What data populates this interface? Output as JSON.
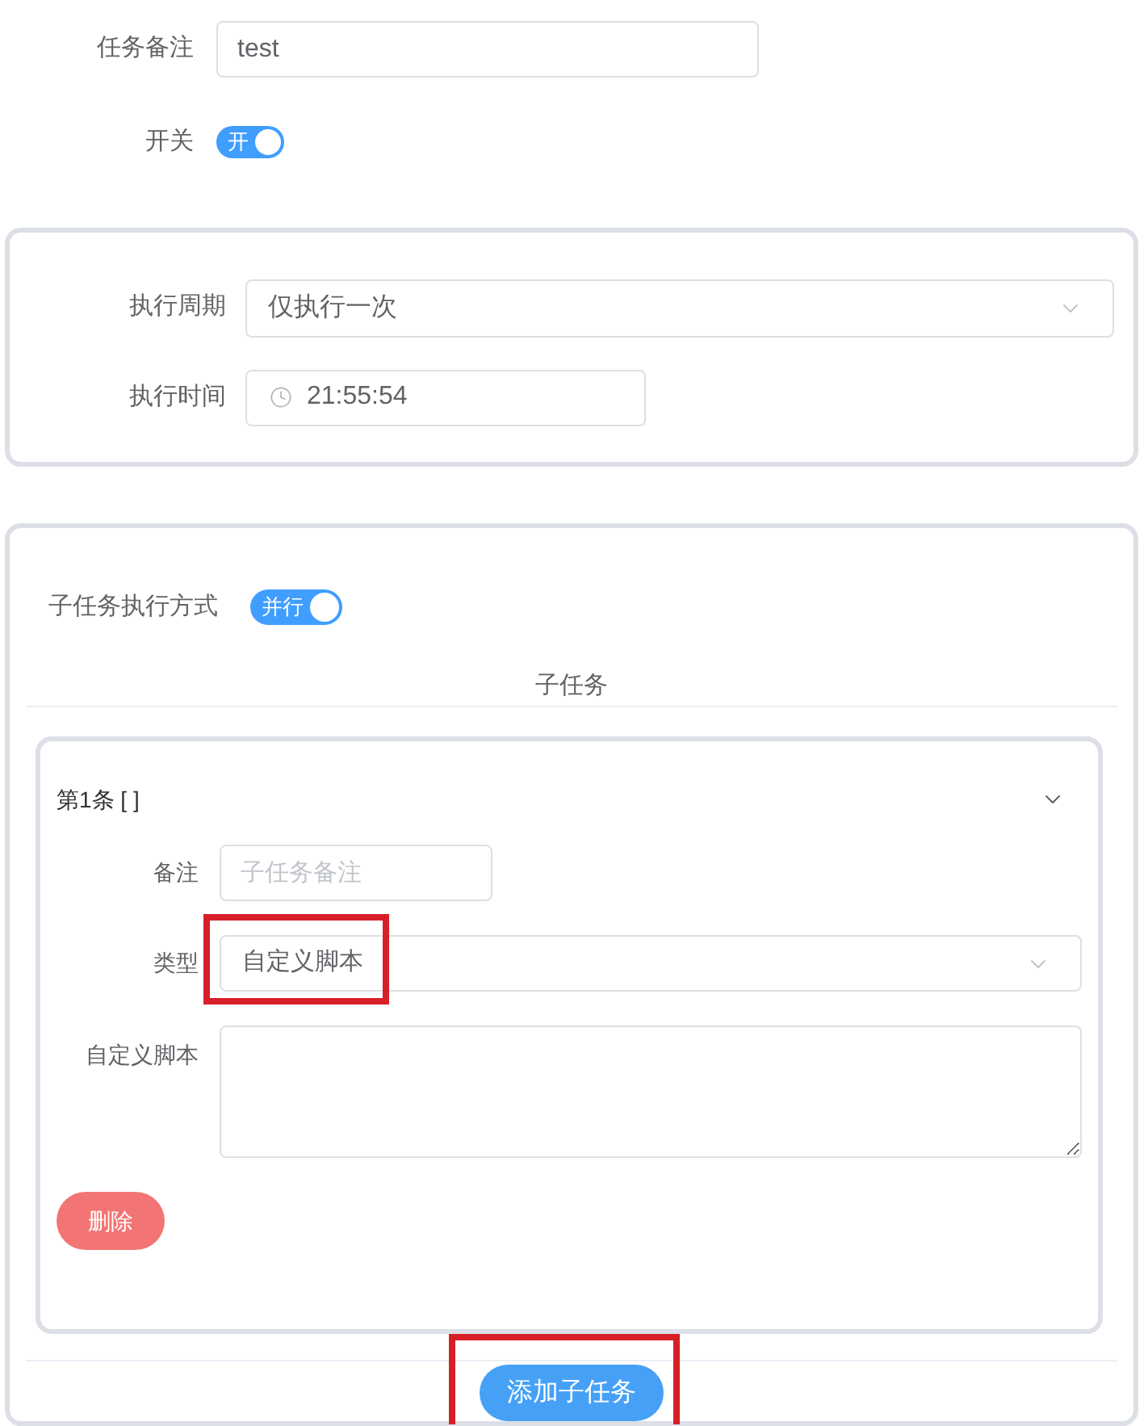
{
  "task_note": {
    "label": "任务备注",
    "value": "test"
  },
  "switch": {
    "label": "开关",
    "on": true,
    "text": "开"
  },
  "schedule_card": {
    "fields": [
      {
        "kind": "select",
        "label": "执行周期",
        "value": "仅执行一次"
      },
      {
        "kind": "time",
        "label": "执行时间",
        "value": "21:55:54"
      }
    ]
  },
  "subtask_card": {
    "mode": {
      "label": "子任务执行方式",
      "on": true,
      "text": "并行"
    },
    "section_title": "子任务",
    "subtasks": [
      {
        "title": "第1条 [ ]",
        "expanded": true,
        "fields": [
          {
            "kind": "input",
            "label": "备注",
            "placeholder": "子任务备注"
          },
          {
            "kind": "select",
            "label": "类型",
            "value": "自定义脚本",
            "highlighted": true
          },
          {
            "kind": "textarea",
            "label": "自定义脚本"
          }
        ],
        "delete_button": "删除"
      }
    ],
    "add_button": {
      "label": "添加子任务",
      "highlighted": true
    }
  }
}
